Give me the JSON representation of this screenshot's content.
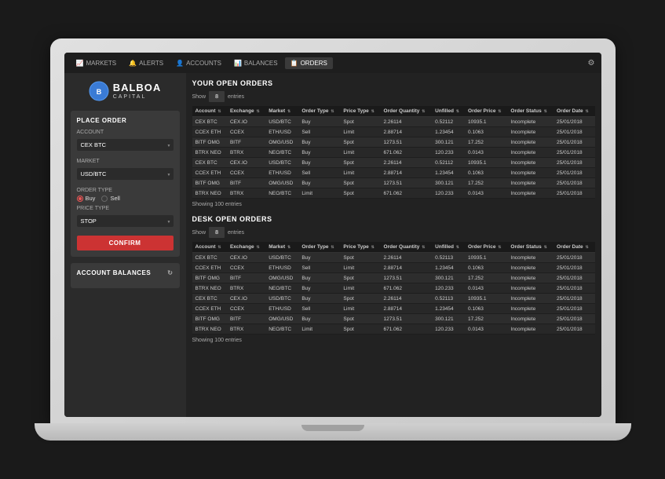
{
  "app": {
    "title": "Balboa Capital"
  },
  "nav": {
    "tabs": [
      {
        "id": "markets",
        "label": "MARKETS",
        "icon": "📈",
        "active": false
      },
      {
        "id": "alerts",
        "label": "ALERTS",
        "icon": "🔔",
        "active": false
      },
      {
        "id": "accounts",
        "label": "ACCOUNTS",
        "icon": "👤",
        "active": false
      },
      {
        "id": "balances",
        "label": "BALANCES",
        "icon": "📊",
        "active": false
      },
      {
        "id": "orders",
        "label": "ORDERS",
        "icon": "📋",
        "active": true
      }
    ],
    "settings_icon": "⚙"
  },
  "left_panel": {
    "logo": {
      "text": "BALBOA",
      "subtext": "CAPITAL"
    },
    "place_order": {
      "title": "PLACE ORDER",
      "account_label": "Account",
      "account_value": "CEX BTC",
      "market_label": "Market",
      "market_value": "USD/BTC",
      "order_type_label": "Order Type",
      "order_type_buy": "Buy",
      "order_type_sell": "Sell",
      "price_type_label": "Price Type",
      "price_type_value": "STOP",
      "confirm_label": "CONFIRM"
    },
    "account_balances": {
      "title": "ACCOUNT BALANCES",
      "refresh_icon": "↻"
    }
  },
  "open_orders": {
    "title": "YOUR OPEN ORDERS",
    "show_label": "Show",
    "show_value": "8",
    "entries_label": "entries",
    "columns": [
      "Account",
      "Exchange",
      "Market",
      "Order Type",
      "Price Type",
      "Order Quantity",
      "Unfilled",
      "Order Price",
      "Order Status",
      "Order Date"
    ],
    "rows": [
      {
        "account": "CEX BTC",
        "exchange": "CEX.IO",
        "market": "USD/BTC",
        "order_type": "Buy",
        "price_type": "Spot",
        "quantity": "2.26114",
        "unfilled": "0.52112",
        "price": "10935.1",
        "status": "Incomplete",
        "date": "25/01/2018"
      },
      {
        "account": "CCEX ETH",
        "exchange": "CCEX",
        "market": "ETH/USD",
        "order_type": "Sell",
        "price_type": "Limit",
        "quantity": "2.88714",
        "unfilled": "1.23454",
        "price": "0.1063",
        "status": "Incomplete",
        "date": "25/01/2018"
      },
      {
        "account": "BITF OMG",
        "exchange": "BITF",
        "market": "OMG/USD",
        "order_type": "Buy",
        "price_type": "Spot",
        "quantity": "1273.51",
        "unfilled": "300.121",
        "price": "17.252",
        "status": "Incomplete",
        "date": "25/01/2018"
      },
      {
        "account": "BTRX NEO",
        "exchange": "BTRX",
        "market": "NEO/BTC",
        "order_type": "Buy",
        "price_type": "Limit",
        "quantity": "671.062",
        "unfilled": "120.233",
        "price": "0.0143",
        "status": "Incomplete",
        "date": "25/01/2018"
      },
      {
        "account": "CEX BTC",
        "exchange": "CEX.IO",
        "market": "USD/BTC",
        "order_type": "Buy",
        "price_type": "Spot",
        "quantity": "2.26114",
        "unfilled": "0.52112",
        "price": "10935.1",
        "status": "Incomplete",
        "date": "25/01/2018"
      },
      {
        "account": "CCEX ETH",
        "exchange": "CCEX",
        "market": "ETH/USD",
        "order_type": "Sell",
        "price_type": "Limit",
        "quantity": "2.88714",
        "unfilled": "1.23454",
        "price": "0.1063",
        "status": "Incomplete",
        "date": "25/01/2018"
      },
      {
        "account": "BITF OMG",
        "exchange": "BITF",
        "market": "OMG/USD",
        "order_type": "Buy",
        "price_type": "Spot",
        "quantity": "1273.51",
        "unfilled": "300.121",
        "price": "17.252",
        "status": "Incomplete",
        "date": "25/01/2018"
      },
      {
        "account": "BTRX NEO",
        "exchange": "BTRX",
        "market": "NEO/BTC",
        "order_type": "Limit",
        "price_type": "Spot",
        "quantity": "671.062",
        "unfilled": "120.233",
        "price": "0.0143",
        "status": "Incomplete",
        "date": "25/01/2018"
      }
    ],
    "showing_text": "Showing 100 entries"
  },
  "desk_orders": {
    "title": "DESK OPEN ORDERS",
    "show_label": "Show",
    "show_value": "8",
    "entries_label": "entries",
    "columns": [
      "Account",
      "Exchange",
      "Market",
      "Order Type",
      "Price Type",
      "Order Quantity",
      "Unfilled",
      "Order Price",
      "Order Status",
      "Order Date"
    ],
    "rows": [
      {
        "account": "CEX BTC",
        "exchange": "CEX.IO",
        "market": "USD/BTC",
        "order_type": "Buy",
        "price_type": "Spot",
        "quantity": "2.26114",
        "unfilled": "0.52113",
        "price": "10935.1",
        "status": "Incomplete",
        "date": "25/01/2018"
      },
      {
        "account": "CCEX ETH",
        "exchange": "CCEX",
        "market": "ETH/USD",
        "order_type": "Sell",
        "price_type": "Limit",
        "quantity": "2.88714",
        "unfilled": "1.23454",
        "price": "0.1063",
        "status": "Incomplete",
        "date": "25/01/2018"
      },
      {
        "account": "BITF OMG",
        "exchange": "BITF",
        "market": "OMG/USD",
        "order_type": "Buy",
        "price_type": "Spot",
        "quantity": "1273.51",
        "unfilled": "300.121",
        "price": "17.252",
        "status": "Incomplete",
        "date": "25/01/2018"
      },
      {
        "account": "BTRX NEO",
        "exchange": "BTRX",
        "market": "NEO/BTC",
        "order_type": "Buy",
        "price_type": "Limit",
        "quantity": "671.062",
        "unfilled": "120.233",
        "price": "0.0143",
        "status": "Incomplete",
        "date": "25/01/2018"
      },
      {
        "account": "CEX BTC",
        "exchange": "CEX.IO",
        "market": "USD/BTC",
        "order_type": "Buy",
        "price_type": "Spot",
        "quantity": "2.26114",
        "unfilled": "0.52113",
        "price": "10935.1",
        "status": "Incomplete",
        "date": "25/01/2018"
      },
      {
        "account": "CCEX ETH",
        "exchange": "CCEX",
        "market": "ETH/USD",
        "order_type": "Sell",
        "price_type": "Limit",
        "quantity": "2.88714",
        "unfilled": "1.23454",
        "price": "0.1063",
        "status": "Incomplete",
        "date": "25/01/2018"
      },
      {
        "account": "BITF OMG",
        "exchange": "BITF",
        "market": "OMG/USD",
        "order_type": "Buy",
        "price_type": "Spot",
        "quantity": "1273.51",
        "unfilled": "300.121",
        "price": "17.252",
        "status": "Incomplete",
        "date": "25/01/2018"
      },
      {
        "account": "BTRX NEO",
        "exchange": "BTRX",
        "market": "NEO/BTC",
        "order_type": "Limit",
        "price_type": "Spot",
        "quantity": "671.062",
        "unfilled": "120.233",
        "price": "0.0143",
        "status": "Incomplete",
        "date": "25/01/2018"
      }
    ],
    "showing_text": "Showing 100 entries"
  }
}
